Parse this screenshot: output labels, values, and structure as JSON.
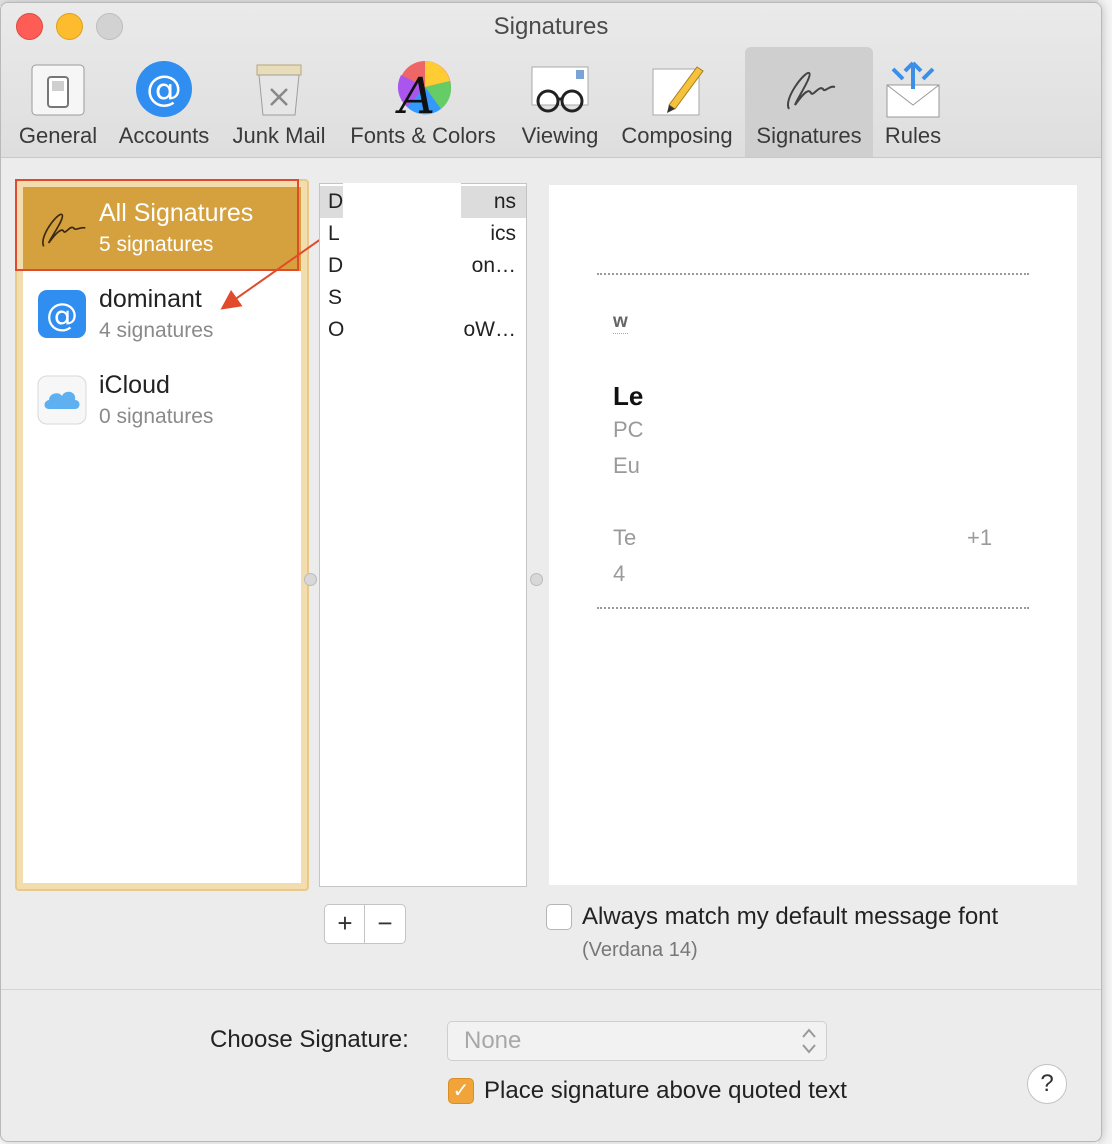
{
  "window": {
    "title": "Signatures"
  },
  "toolbar": {
    "items": [
      {
        "label": "General",
        "icon": "switch-icon"
      },
      {
        "label": "Accounts",
        "icon": "at-sign-icon"
      },
      {
        "label": "Junk Mail",
        "icon": "trash-icon"
      },
      {
        "label": "Fonts & Colors",
        "icon": "color-wheel-font-icon"
      },
      {
        "label": "Viewing",
        "icon": "glasses-envelope-icon"
      },
      {
        "label": "Composing",
        "icon": "pencil-paper-icon"
      },
      {
        "label": "Signatures",
        "icon": "signature-icon"
      },
      {
        "label": "Rules",
        "icon": "envelope-arrows-icon"
      }
    ],
    "active": "Signatures"
  },
  "accounts": [
    {
      "name": "All Signatures",
      "count": "5 signatures",
      "icon": "signature-icon",
      "selected": true
    },
    {
      "name": "dominant",
      "count": "4 signatures",
      "icon": "at-sign-icon"
    },
    {
      "name": "iCloud",
      "count": "0 signatures",
      "icon": "icloud-icon"
    }
  ],
  "signatures": [
    {
      "left": "D",
      "right": "ns"
    },
    {
      "left": "L",
      "right": "ics"
    },
    {
      "left": "D",
      "right": "on…"
    },
    {
      "left": "S",
      "right": ""
    },
    {
      "left": "O",
      "right": "oW…"
    }
  ],
  "preview": {
    "line1": "w",
    "name": "Le",
    "line2": "PC",
    "line3": "Eu",
    "line4a": "Te",
    "line4b": "+1",
    "line5": "4"
  },
  "controls": {
    "add_label": "+",
    "remove_label": "−",
    "match_font_label": "Always match my default message font",
    "match_font_sub": "(Verdana 14)",
    "choose_label": "Choose Signature:",
    "choose_value": "None",
    "place_label": "Place signature above quoted text",
    "place_checked": true,
    "help_label": "?"
  },
  "colors": {
    "accent": "#d5a13e",
    "checkbox": "#f0a43a",
    "annotation": "#e24a2c"
  }
}
